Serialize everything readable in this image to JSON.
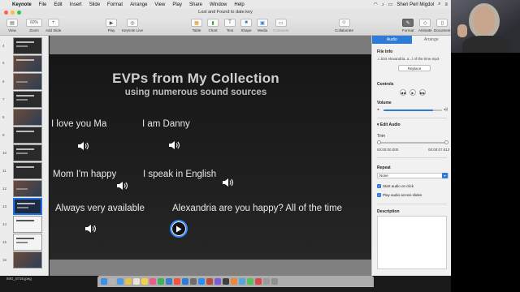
{
  "menubar": {
    "app": "Keynote",
    "items": [
      "File",
      "Edit",
      "Insert",
      "Slide",
      "Format",
      "Arrange",
      "View",
      "Play",
      "Share",
      "Window",
      "Help"
    ],
    "user": "Sheri Perl Migdol"
  },
  "window": {
    "title": "Lost and Found to date.key"
  },
  "toolbar": {
    "view": "View",
    "zoom_value": "60%",
    "zoom": "Zoom",
    "add_slide": "Add Slide",
    "play": "Play",
    "keynote_live": "Keynote Live",
    "table": "Table",
    "chart": "Chart",
    "text": "Text",
    "shape": "Shape",
    "media": "Media",
    "comment": "Comment",
    "collaborate": "Collaborate",
    "format": "Format",
    "animate": "Animate",
    "document": "Document"
  },
  "navigator": {
    "numbers": [
      "4",
      "5",
      "6",
      "7",
      "8",
      "9",
      "10",
      "11",
      "12",
      "13",
      "14",
      "15",
      "16"
    ],
    "selected": "13"
  },
  "slide": {
    "title": "EVPs from My Collection",
    "subtitle": "using numerous sound sources",
    "evps": [
      "I love you Ma",
      "I am Danny",
      "Mom I'm happy",
      "I speak in English",
      "Always very available",
      "Alexandria are you happy? All of the time"
    ]
  },
  "inspector": {
    "tab_audio": "Audio",
    "tab_arrange": "Arrange",
    "file_info_label": "File Info",
    "file_name": "b34 Alexandria, a...l of the time.mp3",
    "replace": "Replace",
    "controls_label": "Controls",
    "volume_label": "Volume",
    "volume_level": 0.85,
    "edit_audio": "Edit Audio",
    "trim_label": "Trim",
    "trim_start": "00:00:00.000",
    "trim_end": "00:00:07.813",
    "repeat_label": "Repeat",
    "repeat_value": "None",
    "start_on_click": "Start audio on click",
    "play_across_slides": "Play audio across slides",
    "description_label": "Description"
  },
  "dock": {
    "file": "IMG_0716.jpeg"
  },
  "colors": {
    "accent": "#2f7bd8",
    "selection": "#2f86ff"
  }
}
